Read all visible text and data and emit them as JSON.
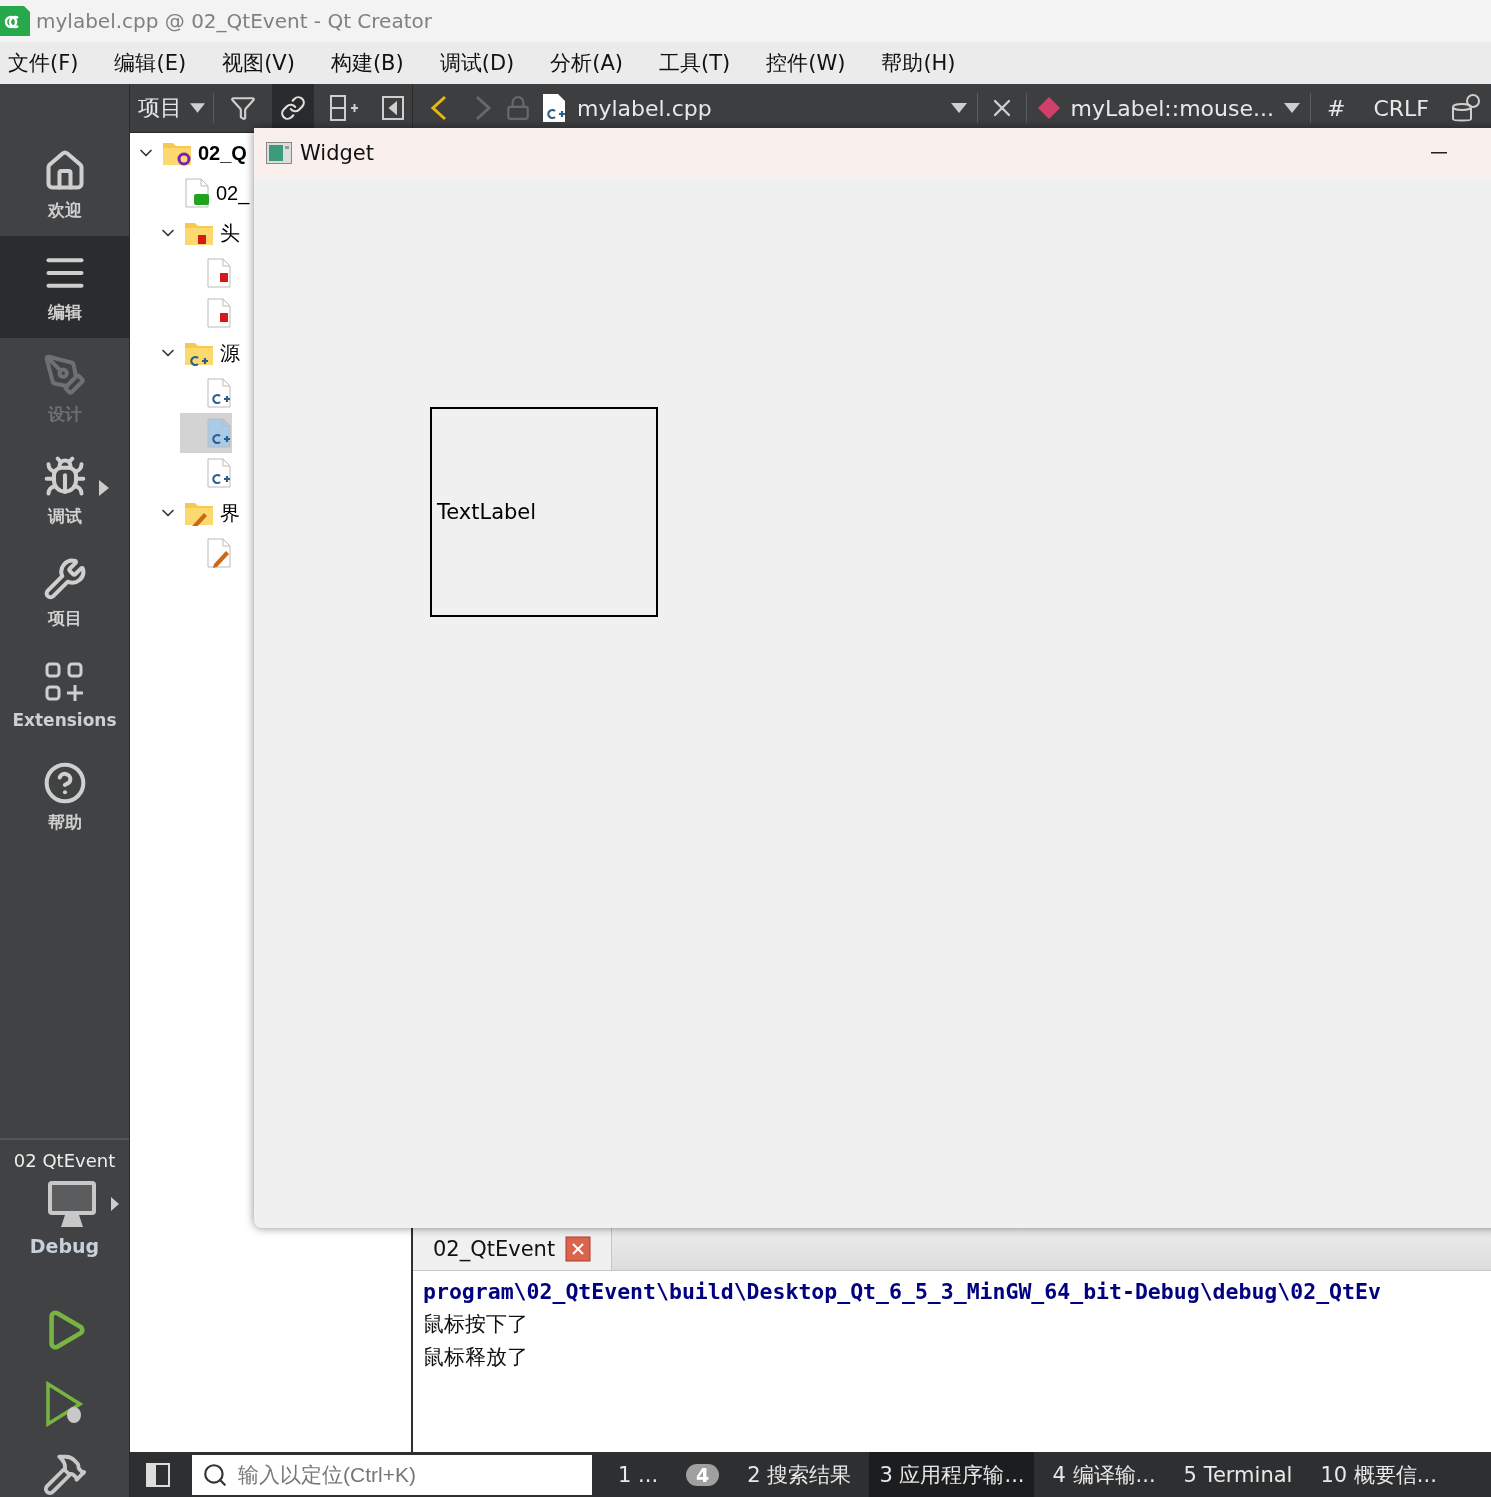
{
  "window": {
    "title": "mylabel.cpp @ 02_QtEvent - Qt Creator"
  },
  "menu": [
    "文件(F)",
    "编辑(E)",
    "视图(V)",
    "构建(B)",
    "调试(D)",
    "分析(A)",
    "工具(T)",
    "控件(W)",
    "帮助(H)"
  ],
  "modes": [
    {
      "label": "欢迎",
      "selected": false,
      "disabled": false,
      "has_menu": false
    },
    {
      "label": "编辑",
      "selected": true,
      "disabled": false,
      "has_menu": false
    },
    {
      "label": "设计",
      "selected": false,
      "disabled": true,
      "has_menu": false
    },
    {
      "label": "调试",
      "selected": false,
      "disabled": false,
      "has_menu": true
    },
    {
      "label": "项目",
      "selected": false,
      "disabled": false,
      "has_menu": false
    },
    {
      "label": "Extensions",
      "selected": false,
      "disabled": false,
      "has_menu": false
    },
    {
      "label": "帮助",
      "selected": false,
      "disabled": false,
      "has_menu": false
    }
  ],
  "kit": {
    "project": "02 QtEvent",
    "build": "Debug"
  },
  "toolbar": {
    "view": "项目",
    "file": "mylabel.cpp",
    "symbol": "myLabel::mouse...",
    "hash": "#",
    "line_ending": "CRLF"
  },
  "tree": [
    {
      "kind": "project",
      "label": "02_Q",
      "expanded": true,
      "selected": false,
      "children": [
        {
          "kind": "qt",
          "label": "02_",
          "selected": false
        },
        {
          "kind": "header-folder",
          "label": "头",
          "expanded": true,
          "selected": false,
          "children": [
            {
              "kind": "header",
              "selected": false
            },
            {
              "kind": "header",
              "selected": false
            }
          ]
        },
        {
          "kind": "source-folder",
          "label": "源",
          "expanded": true,
          "selected": false,
          "children": [
            {
              "kind": "source",
              "selected": false
            },
            {
              "kind": "source",
              "selected": true
            },
            {
              "kind": "source",
              "selected": false
            }
          ]
        },
        {
          "kind": "form-folder",
          "label": "界",
          "expanded": true,
          "selected": false,
          "children": [
            {
              "kind": "form",
              "selected": false
            }
          ]
        }
      ]
    }
  ],
  "widget": {
    "title": "Widget",
    "label": "TextLabel"
  },
  "output": {
    "tabs": [
      {
        "label": "02_QtEvent",
        "selected": true
      }
    ],
    "lines": [
      {
        "kind": "path",
        "text": "program\\02_QtEvent\\build\\Desktop_Qt_6_5_3_MinGW_64_bit-Debug\\debug\\02_QtEv"
      },
      {
        "kind": "message",
        "text": "鼠标按下了"
      },
      {
        "kind": "message",
        "text": "鼠标释放了"
      }
    ]
  },
  "status_bar": {
    "locator_placeholder": "输入以定位(Ctrl+K)",
    "panes": [
      {
        "number": "1",
        "label": "...",
        "badge": "4",
        "selected": false
      },
      {
        "number": "2",
        "label": "搜索结果",
        "selected": false
      },
      {
        "number": "3",
        "label": "应用程序输...",
        "selected": true
      },
      {
        "number": "4",
        "label": "编译输...",
        "selected": false
      },
      {
        "number": "5",
        "label": "Terminal",
        "selected": false
      },
      {
        "number": "10",
        "label": "概要信...",
        "selected": false
      }
    ]
  }
}
